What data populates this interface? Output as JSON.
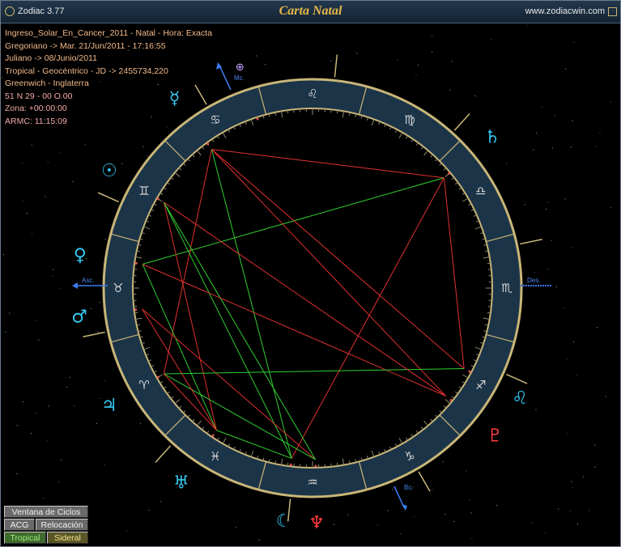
{
  "window": {
    "app_title": "Zodiac 3.77",
    "chart_title": "Carta Natal",
    "website": "www.zodiacwin.com"
  },
  "info": {
    "line1": "Ingreso_Solar_En_Cancer_2011 - Natal - Hora: Exacta",
    "line2": "Gregoriano -> Mar. 21/Jun/2011 - 17:16:55",
    "line3": "Juliano -> 08/Junio/2011",
    "line4": "Tropical - Geocéntrico - JD -> 2455734,220",
    "line5": "Greenwich - Inglaterra",
    "line6": "51 N 29 - 00 O 00",
    "line7": "Zona: +00:00:00",
    "line8": "ARMC: 11:15:09"
  },
  "axes": {
    "mc": "Mc.",
    "asc": "Asc.",
    "des": "Des.",
    "bc": "Bc."
  },
  "zodiac_signs": [
    {
      "name": "aries",
      "glyph": "♈",
      "angle_deg": 210
    },
    {
      "name": "taurus",
      "glyph": "♉",
      "angle_deg": 180
    },
    {
      "name": "gemini",
      "glyph": "♊",
      "angle_deg": 150
    },
    {
      "name": "cancer",
      "glyph": "♋",
      "angle_deg": 120
    },
    {
      "name": "leo",
      "glyph": "♌",
      "angle_deg": 90
    },
    {
      "name": "virgo",
      "glyph": "♍",
      "angle_deg": 60
    },
    {
      "name": "libra",
      "glyph": "♎",
      "angle_deg": 30
    },
    {
      "name": "scorpio",
      "glyph": "♏",
      "angle_deg": 0
    },
    {
      "name": "sagittarius",
      "glyph": "♐",
      "angle_deg": 330
    },
    {
      "name": "capricorn",
      "glyph": "♑",
      "angle_deg": 300
    },
    {
      "name": "aquarius",
      "glyph": "♒",
      "angle_deg": 270
    },
    {
      "name": "pisces",
      "glyph": "♓",
      "angle_deg": 240
    }
  ],
  "planets": [
    {
      "name": "sun",
      "glyph": "☉",
      "angle_deg": 150,
      "color": "#33c8f0"
    },
    {
      "name": "mercury",
      "glyph": "☿",
      "angle_deg": 126,
      "color": "#33c8f0"
    },
    {
      "name": "venus",
      "glyph": "♀",
      "angle_deg": 172,
      "color": "#33c8f0"
    },
    {
      "name": "mars",
      "glyph": "♂",
      "angle_deg": 187,
      "color": "#33c8f0"
    },
    {
      "name": "jupiter",
      "glyph": "♃",
      "angle_deg": 210,
      "color": "#33c8f0"
    },
    {
      "name": "uranus",
      "glyph": "♅",
      "angle_deg": 236,
      "color": "#33c8f0"
    },
    {
      "name": "moon",
      "glyph": "☾",
      "angle_deg": 263,
      "color": "#33c8f0"
    },
    {
      "name": "neptune",
      "glyph": "♆",
      "angle_deg": 271,
      "color": "#ff3b3b"
    },
    {
      "name": "pluto",
      "glyph": "♇",
      "angle_deg": 321,
      "color": "#ff3b3b"
    },
    {
      "name": "leo-point",
      "glyph": "♌",
      "angle_deg": 332,
      "color": "#33c8f0"
    },
    {
      "name": "saturn",
      "glyph": "♄",
      "angle_deg": 40,
      "color": "#33c8f0"
    },
    {
      "name": "part-of-fortune",
      "glyph": "⊕",
      "angle_deg": 108,
      "color": "#c8a0ff"
    }
  ],
  "buttons": {
    "ventana": "Ventana de Ciclos",
    "acg": "ACG",
    "relocacion": "Relocación",
    "tropical": "Tropical",
    "sideral": "Sideral"
  },
  "colors": {
    "background": "#000000",
    "ring": "#1c3448",
    "ring_border": "#c8b678",
    "aspect_red": "#e03030",
    "aspect_green": "#30d030",
    "title_gold": "#e7b84a"
  }
}
